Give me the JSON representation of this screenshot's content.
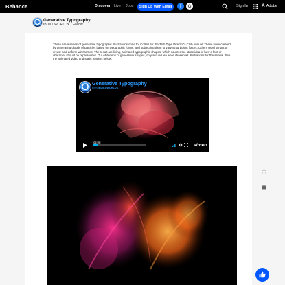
{
  "nav": {
    "logo": "Bēhance",
    "discover": "Discover",
    "live": "Live",
    "jobs": "Jobs",
    "signup": "Sign Up With Email",
    "or": "or",
    "fb_glyph": "f",
    "google_glyph": "G",
    "signin": "Sign In",
    "adobe_mark": "A",
    "adobe": "Adobe"
  },
  "project": {
    "title": "Generative Typography",
    "owner": "IBUILDWORLDS",
    "separator": "•",
    "follow": "Follow",
    "description": "These are a series of generative typographic illustrations done for Collins for the 35th Type Director's Club Annual. These were created by generating clouds of particles based on typographic forms, and subjecting them to varying turbulent forces. Others used scripts to create and deform wireframes. The result are living, animated typographic shapes, which counter the static idea of how a font or character should be represented. Out of dozens of generative shapes, only around ten were chosen as illustrations for the annual. See the animated video and static renders below."
  },
  "video": {
    "title": "Generative Typography",
    "from_label": "from",
    "from_owner": "IBUILDWORLDS",
    "time": "01:19",
    "progress": 0.09,
    "vimeo": "vimeo"
  },
  "icons": {
    "share": "share-icon",
    "save": "save-icon",
    "appreciate": "thumbs-up-icon",
    "search": "search-icon",
    "apps": "apps-grid-icon"
  },
  "colors": {
    "brand_blue": "#0057ff",
    "video_title": "#2f9bff",
    "particle_pink": "#e0307a",
    "particle_orange": "#ff8a1e"
  }
}
